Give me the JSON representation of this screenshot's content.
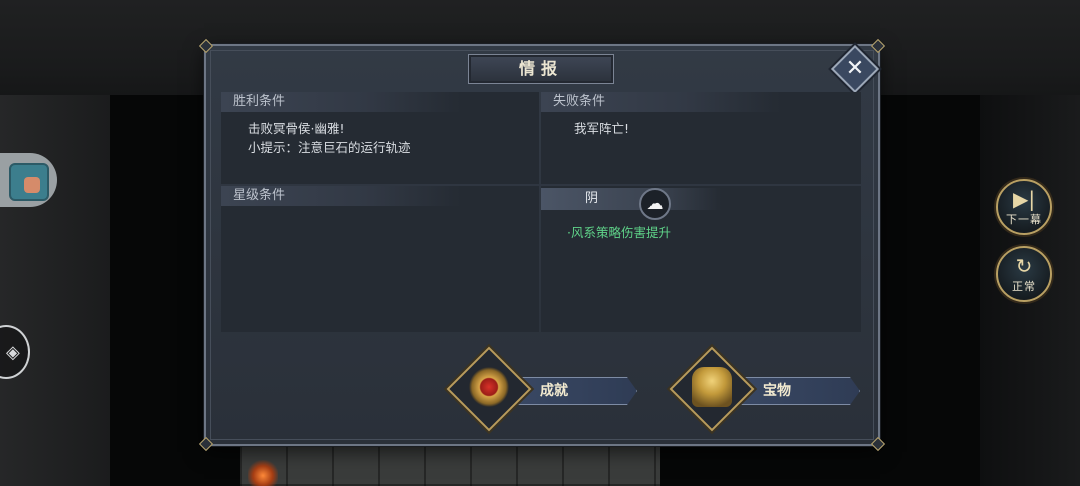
{
  "dialog": {
    "title": "情报",
    "close_label": "✕",
    "win": {
      "header": "胜利条件",
      "lines": [
        "击败冥骨侯·幽雅!",
        "小提示：注意巨石的运行轨迹"
      ]
    },
    "lose": {
      "header": "失败条件",
      "lines": [
        "我军阵亡!"
      ]
    },
    "star": {
      "header": "星级条件"
    },
    "weather": {
      "label": "阴",
      "icon": "cloud-icon",
      "effect": "·风系策略伤害提升"
    },
    "buttons": {
      "achievement": "成就",
      "treasure": "宝物"
    }
  },
  "side": {
    "next_label": "下一幕",
    "normal_label": "正常",
    "next_icon": "skip-forward-icon",
    "normal_icon": "speed-normal-icon"
  },
  "colors": {
    "effect_text": "#5fd389",
    "dialog_bg": "#2a3039",
    "gold_trim": "#b89b5c"
  }
}
